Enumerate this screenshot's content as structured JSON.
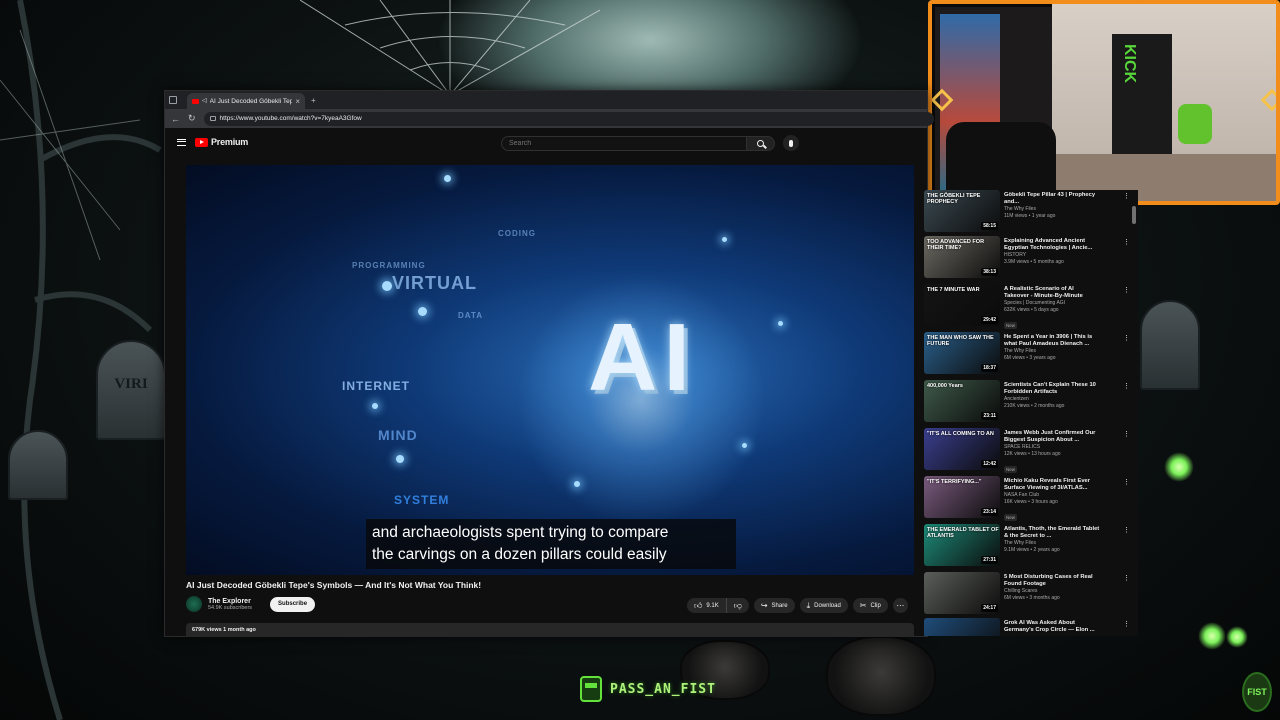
{
  "browser": {
    "tab_title": "AI Just Decoded Göbekli Tepe",
    "tab_close": "×",
    "new_tab": "+",
    "url": "https://www.youtube.com/watch?v=7kyeaA3Gfow",
    "back": "←",
    "reload": "↻"
  },
  "youtube": {
    "logo_text": "Premium",
    "search_placeholder": "Search"
  },
  "player": {
    "words": [
      "PROGRAMMING",
      "VIRTUAL",
      "INTERNET",
      "MIND",
      "SYSTEM",
      "DATA",
      "CODING"
    ],
    "ai_text": "AI",
    "caption_line1": "and archaeologists spent trying to compare",
    "caption_line2": "the carvings on a dozen pillars could easily"
  },
  "video": {
    "title": "AI Just Decoded Göbekli Tepe's Symbols — And It's Not What You Think!",
    "channel_name": "The Explorer",
    "channel_subs": "54.9K subscribers",
    "subscribe_label": "Subscribe",
    "likes": "9.1K",
    "share_label": "Share",
    "download_label": "Download",
    "clip_label": "Clip",
    "more": "⋯",
    "stats": "679K views  1 month ago"
  },
  "recommendations": [
    {
      "thumb_text": "THE GÖBEKLI TEPE PROPHECY",
      "duration": "58:15",
      "title": "Göbekli Tepe Pillar 43 | Prophecy and...",
      "channel": "The Why Files",
      "meta": "11M views • 1 year ago",
      "new": "",
      "thumb_color": "#3b4a52"
    },
    {
      "thumb_text": "TOO ADVANCED FOR THEIR TIME?",
      "duration": "38:13",
      "title": "Explaining Advanced Ancient Egyptian Technologies | Ancie...",
      "channel": "HISTORY",
      "meta": "3.9M views • 5 months ago",
      "new": "",
      "thumb_color": "#6c6a62"
    },
    {
      "thumb_text": "THE 7 MINUTE WAR",
      "duration": "29:42",
      "title": "A Realistic Scenario of AI Takeover - Minute-By-Minute",
      "channel": "Species | Documenting AGI",
      "meta": "632K views • 5 days ago",
      "new": "New",
      "thumb_color": "#141414"
    },
    {
      "thumb_text": "THE MAN WHO SAW THE FUTURE",
      "duration": "18:37",
      "title": "He Spent a Year in 3906 | This is what Paul Amadeus Dienach ...",
      "channel": "The Why Files",
      "meta": "6M views • 3 years ago",
      "new": "",
      "thumb_color": "#2a5f8a"
    },
    {
      "thumb_text": "400,000 Years",
      "duration": "23:11",
      "title": "Scientists Can't Explain These 10 Forbidden Artifacts",
      "channel": "Ancientzen",
      "meta": "210K views • 2 months ago",
      "new": "",
      "thumb_color": "#3e5a4a"
    },
    {
      "thumb_text": "\"IT'S ALL COMING TO AN",
      "duration": "12:42",
      "title": "James Webb Just Confirmed Our Biggest Suspicion About ...",
      "channel": "SPACE RELICS",
      "meta": "12K views • 13 hours ago",
      "new": "New",
      "thumb_color": "#3a3f8e"
    },
    {
      "thumb_text": "\"IT'S TERRIFYING...\"",
      "duration": "23:14",
      "title": "Michio Kaku Reveals First Ever Surface Viewing of 3I/ATLAS...",
      "channel": "NASA Fan Club",
      "meta": "16K views • 3 hours ago",
      "new": "New",
      "thumb_color": "#7a5b7e"
    },
    {
      "thumb_text": "THE EMERALD TABLET OF ATLANTIS",
      "duration": "27:31",
      "title": "Atlantis, Thoth, the Emerald Tablet & the Secret to ...",
      "channel": "The Why Files",
      "meta": "9.1M views • 2 years ago",
      "new": "",
      "thumb_color": "#1d8a78"
    },
    {
      "thumb_text": "",
      "duration": "24:17",
      "title": "5 Most Disturbing Cases of Real Found Footage",
      "channel": "Chilling Scares",
      "meta": "6M views • 3 months ago",
      "new": "",
      "thumb_color": "#5b5e5a"
    },
    {
      "thumb_text": "",
      "duration": "",
      "title": "Grok AI Was Asked About Germany's Crop Circle — Elon ...",
      "channel": "",
      "meta": "",
      "new": "",
      "thumb_color": "#1f4d7a"
    }
  ],
  "overlay": {
    "streamer_name": "PASS_AN_FIST",
    "webcam_banner": "KICK",
    "corner_logo": "FIST"
  },
  "colors": {
    "webcam_border": "#f28c1a",
    "accent_green": "#63e23c",
    "youtube_red": "#ff0000"
  }
}
